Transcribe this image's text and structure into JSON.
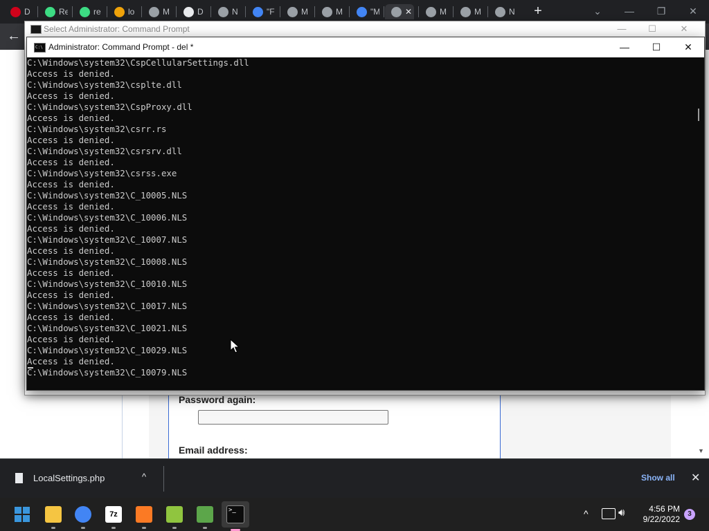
{
  "browser": {
    "tabs": [
      {
        "icon": "opera-icon",
        "label": "D",
        "color": "#d0021b"
      },
      {
        "icon": "android-icon",
        "label": "Re",
        "color": "#3ddc84"
      },
      {
        "icon": "android-icon",
        "label": "re",
        "color": "#3ddc84"
      },
      {
        "icon": "phpmyadmin-icon",
        "label": "lo",
        "color": "#f0a30a"
      },
      {
        "icon": "globe-icon",
        "label": "M",
        "color": "#9aa0a6"
      },
      {
        "icon": "download-icon",
        "label": "D",
        "color": "#e8eaed"
      },
      {
        "icon": "chrome-icon",
        "label": "N",
        "color": "#9aa0a6"
      },
      {
        "icon": "google-icon",
        "label": "\"F",
        "color": "#4285f4"
      },
      {
        "icon": "globe-icon",
        "label": "M",
        "color": "#9aa0a6"
      },
      {
        "icon": "globe-icon",
        "label": "M",
        "color": "#9aa0a6"
      },
      {
        "icon": "google-icon",
        "label": "\"M",
        "color": "#4285f4"
      },
      {
        "icon": "globe-icon",
        "label": "✕",
        "color": "#9aa0a6",
        "active": true
      },
      {
        "icon": "globe-icon",
        "label": "M",
        "color": "#9aa0a6"
      },
      {
        "icon": "globe-icon",
        "label": "M",
        "color": "#9aa0a6"
      },
      {
        "icon": "chrome-icon",
        "label": "N",
        "color": "#9aa0a6"
      }
    ],
    "newtab_label": "+",
    "controls": {
      "dropdown": "⌄",
      "minimize": "—",
      "restore": "❐",
      "close": "✕"
    }
  },
  "background_window": {
    "title": "Select Administrator: Command Prompt",
    "controls": {
      "minimize": "—",
      "maximize": "☐",
      "close": "✕"
    }
  },
  "console_window": {
    "title": "Administrator: Command Prompt - del  *",
    "controls": {
      "minimize": "—",
      "maximize": "☐",
      "close": "✕"
    },
    "lines": [
      "C:\\Windows\\system32\\CspCellularSettings.dll",
      "Access is denied.",
      "C:\\Windows\\system32\\csplte.dll",
      "Access is denied.",
      "C:\\Windows\\system32\\CspProxy.dll",
      "Access is denied.",
      "C:\\Windows\\system32\\csrr.rs",
      "Access is denied.",
      "C:\\Windows\\system32\\csrsrv.dll",
      "Access is denied.",
      "C:\\Windows\\system32\\csrss.exe",
      "Access is denied.",
      "C:\\Windows\\system32\\C_10005.NLS",
      "Access is denied.",
      "C:\\Windows\\system32\\C_10006.NLS",
      "Access is denied.",
      "C:\\Windows\\system32\\C_10007.NLS",
      "Access is denied.",
      "C:\\Windows\\system32\\C_10008.NLS",
      "Access is denied.",
      "C:\\Windows\\system32\\C_10010.NLS",
      "Access is denied.",
      "C:\\Windows\\system32\\C_10017.NLS",
      "Access is denied.",
      "C:\\Windows\\system32\\C_10021.NLS",
      "Access is denied.",
      "C:\\Windows\\system32\\C_10029.NLS",
      "Access is denied.",
      "C:\\Windows\\system32\\C_10079.NLS"
    ]
  },
  "web_page": {
    "password_again_label": "Password again:",
    "email_label": "Email address:"
  },
  "download_bar": {
    "file_name": "LocalSettings.php",
    "chevron": "^",
    "show_all": "Show all",
    "close": "✕"
  },
  "taskbar": {
    "apps": [
      {
        "name": "start-button",
        "icon": "windows-icon",
        "color": "#3a96dd"
      },
      {
        "name": "file-explorer",
        "icon": "folder-icon",
        "color": "#f5c542",
        "dot": true
      },
      {
        "name": "chrome",
        "icon": "chrome-icon",
        "color": "#4285f4",
        "dot": true
      },
      {
        "name": "7zip",
        "icon": "7zip-icon",
        "color": "#ffffff",
        "dot": true,
        "text": "7z"
      },
      {
        "name": "xampp",
        "icon": "xampp-icon",
        "color": "#fb7a24",
        "dot": true
      },
      {
        "name": "notepad-plus-plus",
        "icon": "notepad-icon",
        "color": "#90c53f",
        "dot": true
      },
      {
        "name": "gimp-like",
        "icon": "lizard-icon",
        "color": "#5ca64a",
        "dot": true
      },
      {
        "name": "command-prompt",
        "icon": "terminal-icon",
        "color": "#0c0c0c",
        "dot": true,
        "active": true
      }
    ],
    "tray_chevron": "^",
    "time": "4:56 PM",
    "date": "9/22/2022",
    "notification_count": "3"
  }
}
